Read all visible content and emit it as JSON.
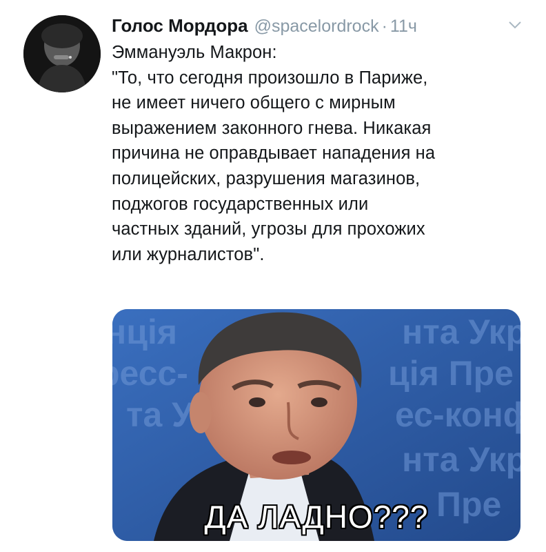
{
  "tweet": {
    "display_name": "Голос Мордора",
    "handle": "@spacelordrock",
    "separator": "·",
    "time": "11ч",
    "text": "Эммануэль Макрон:\n\"То, что сегодня произошло в Париже,\nне имеет ничего общего с мирным\nвыражением законного гнева. Никакая\nпричина не оправдывает нападения на\nполицейских, разрушения магазинов,\nподжогов государственных или\nчастных зданий, угрозы для прохожих\nили журналистов\".",
    "media_caption": "ДА ЛАДНО???",
    "background_sign_fragments": [
      "нція",
      "нта Укр",
      "ресс-",
      "ція Пре",
      "та У",
      "ес-конф",
      "нта Укра",
      "Пре"
    ]
  },
  "colors": {
    "text": "#14171a",
    "muted": "#8899a6",
    "media_bg": "#2f5ea6"
  },
  "icons": {
    "more": "chevron-down-icon"
  }
}
